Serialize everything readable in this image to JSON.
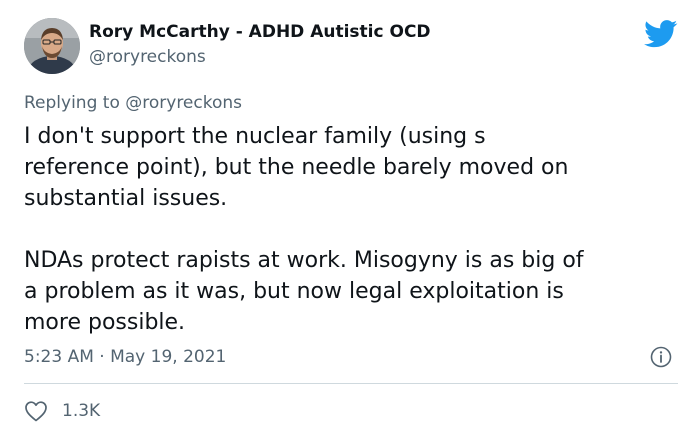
{
  "author": {
    "name": "Rory McCarthy - ADHD Autistic OCD",
    "handle": "@roryreckons"
  },
  "reply": {
    "prefix": "Replying to ",
    "mention": "@roryreckons"
  },
  "tweet": {
    "text": "I don't support the nuclear family (using s\nreference point), but the needle barely moved on\nsubstantial issues.\n\nNDAs protect rapists at work. Misogyny is as big of\na problem as it was, but now legal exploitation is\nmore possible.",
    "timestamp": "5:23 AM · May 19, 2021",
    "likes": "1.3K"
  },
  "icons": {
    "brand": "twitter-bird-icon",
    "info": "info-icon",
    "like": "heart-icon"
  },
  "colors": {
    "brand": "#1d9bf0",
    "secondary_text": "#536471",
    "primary_text": "#0f1419",
    "divider": "#cfd9de"
  }
}
